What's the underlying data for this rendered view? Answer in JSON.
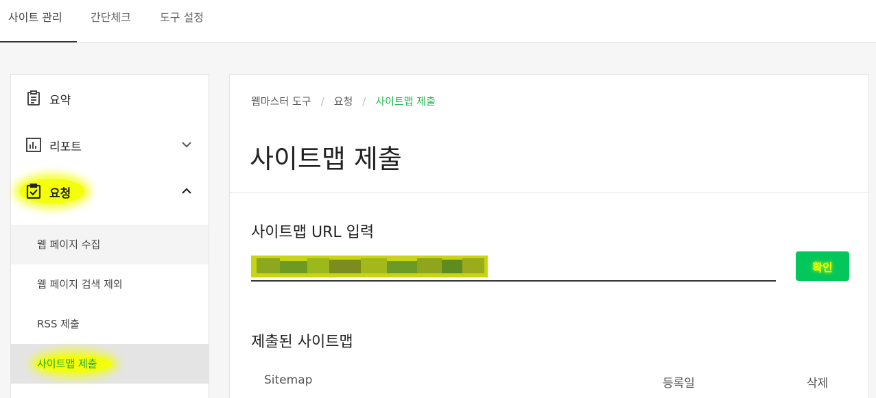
{
  "top_nav": {
    "tabs": [
      "사이트 관리",
      "간단체크",
      "도구 설정"
    ],
    "active": "사이트 관리"
  },
  "sidebar": {
    "main_items": [
      {
        "label": "요약",
        "icon": "clipboard-icon"
      },
      {
        "label": "리포트",
        "icon": "bar-chart-icon",
        "expanded": false
      },
      {
        "label": "요청",
        "icon": "clipboard-check-icon",
        "expanded": true,
        "highlighted": true
      }
    ],
    "sub_items": [
      {
        "label": "웹 페이지 수집"
      },
      {
        "label": "웹 페이지 검색 제외"
      },
      {
        "label": "RSS 제출"
      },
      {
        "label": "사이트맵 제출",
        "active": true
      }
    ]
  },
  "main": {
    "breadcrumb": [
      "웹마스터 도구",
      "요청",
      "사이트맵 제출"
    ],
    "title": "사이트맵 제출",
    "url_section_title": "사이트맵 URL 입력",
    "confirm_label": "확인",
    "submitted_title": "제출된 사이트맵",
    "table_headers": [
      "Sitemap",
      "등록일",
      "삭제"
    ]
  },
  "colors": {
    "accent": "#03c75a",
    "active_text": "#1fa82b",
    "highlight": "#f2ff00"
  }
}
